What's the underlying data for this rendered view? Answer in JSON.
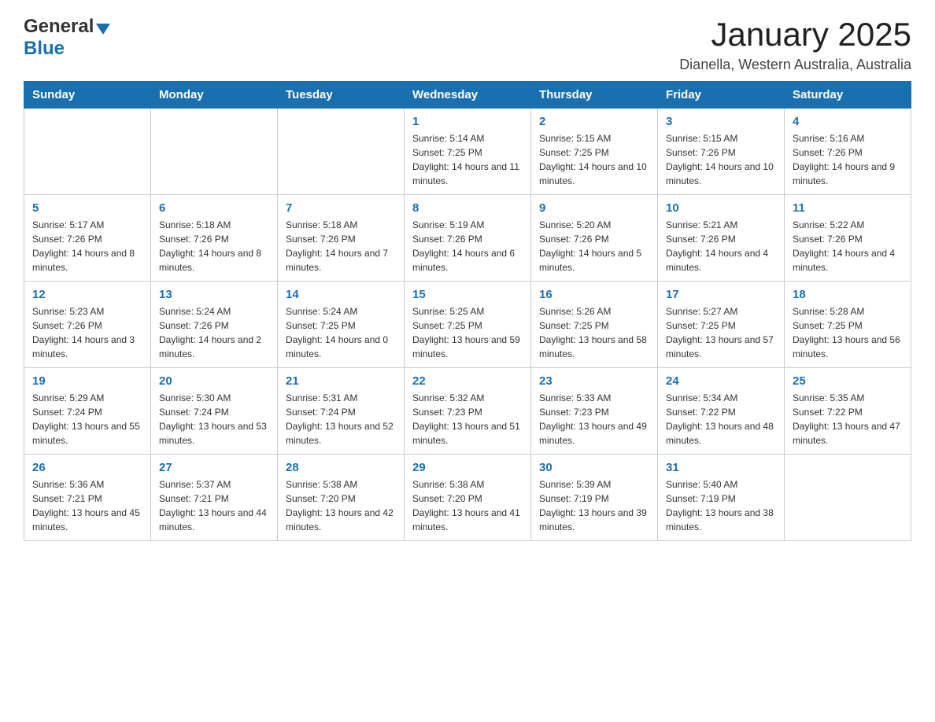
{
  "logo": {
    "general": "General",
    "blue": "Blue"
  },
  "header": {
    "month_year": "January 2025",
    "location": "Dianella, Western Australia, Australia"
  },
  "days_of_week": [
    "Sunday",
    "Monday",
    "Tuesday",
    "Wednesday",
    "Thursday",
    "Friday",
    "Saturday"
  ],
  "weeks": [
    [
      {
        "day": "",
        "info": ""
      },
      {
        "day": "",
        "info": ""
      },
      {
        "day": "",
        "info": ""
      },
      {
        "day": "1",
        "info": "Sunrise: 5:14 AM\nSunset: 7:25 PM\nDaylight: 14 hours and 11 minutes."
      },
      {
        "day": "2",
        "info": "Sunrise: 5:15 AM\nSunset: 7:25 PM\nDaylight: 14 hours and 10 minutes."
      },
      {
        "day": "3",
        "info": "Sunrise: 5:15 AM\nSunset: 7:26 PM\nDaylight: 14 hours and 10 minutes."
      },
      {
        "day": "4",
        "info": "Sunrise: 5:16 AM\nSunset: 7:26 PM\nDaylight: 14 hours and 9 minutes."
      }
    ],
    [
      {
        "day": "5",
        "info": "Sunrise: 5:17 AM\nSunset: 7:26 PM\nDaylight: 14 hours and 8 minutes."
      },
      {
        "day": "6",
        "info": "Sunrise: 5:18 AM\nSunset: 7:26 PM\nDaylight: 14 hours and 8 minutes."
      },
      {
        "day": "7",
        "info": "Sunrise: 5:18 AM\nSunset: 7:26 PM\nDaylight: 14 hours and 7 minutes."
      },
      {
        "day": "8",
        "info": "Sunrise: 5:19 AM\nSunset: 7:26 PM\nDaylight: 14 hours and 6 minutes."
      },
      {
        "day": "9",
        "info": "Sunrise: 5:20 AM\nSunset: 7:26 PM\nDaylight: 14 hours and 5 minutes."
      },
      {
        "day": "10",
        "info": "Sunrise: 5:21 AM\nSunset: 7:26 PM\nDaylight: 14 hours and 4 minutes."
      },
      {
        "day": "11",
        "info": "Sunrise: 5:22 AM\nSunset: 7:26 PM\nDaylight: 14 hours and 4 minutes."
      }
    ],
    [
      {
        "day": "12",
        "info": "Sunrise: 5:23 AM\nSunset: 7:26 PM\nDaylight: 14 hours and 3 minutes."
      },
      {
        "day": "13",
        "info": "Sunrise: 5:24 AM\nSunset: 7:26 PM\nDaylight: 14 hours and 2 minutes."
      },
      {
        "day": "14",
        "info": "Sunrise: 5:24 AM\nSunset: 7:25 PM\nDaylight: 14 hours and 0 minutes."
      },
      {
        "day": "15",
        "info": "Sunrise: 5:25 AM\nSunset: 7:25 PM\nDaylight: 13 hours and 59 minutes."
      },
      {
        "day": "16",
        "info": "Sunrise: 5:26 AM\nSunset: 7:25 PM\nDaylight: 13 hours and 58 minutes."
      },
      {
        "day": "17",
        "info": "Sunrise: 5:27 AM\nSunset: 7:25 PM\nDaylight: 13 hours and 57 minutes."
      },
      {
        "day": "18",
        "info": "Sunrise: 5:28 AM\nSunset: 7:25 PM\nDaylight: 13 hours and 56 minutes."
      }
    ],
    [
      {
        "day": "19",
        "info": "Sunrise: 5:29 AM\nSunset: 7:24 PM\nDaylight: 13 hours and 55 minutes."
      },
      {
        "day": "20",
        "info": "Sunrise: 5:30 AM\nSunset: 7:24 PM\nDaylight: 13 hours and 53 minutes."
      },
      {
        "day": "21",
        "info": "Sunrise: 5:31 AM\nSunset: 7:24 PM\nDaylight: 13 hours and 52 minutes."
      },
      {
        "day": "22",
        "info": "Sunrise: 5:32 AM\nSunset: 7:23 PM\nDaylight: 13 hours and 51 minutes."
      },
      {
        "day": "23",
        "info": "Sunrise: 5:33 AM\nSunset: 7:23 PM\nDaylight: 13 hours and 49 minutes."
      },
      {
        "day": "24",
        "info": "Sunrise: 5:34 AM\nSunset: 7:22 PM\nDaylight: 13 hours and 48 minutes."
      },
      {
        "day": "25",
        "info": "Sunrise: 5:35 AM\nSunset: 7:22 PM\nDaylight: 13 hours and 47 minutes."
      }
    ],
    [
      {
        "day": "26",
        "info": "Sunrise: 5:36 AM\nSunset: 7:21 PM\nDaylight: 13 hours and 45 minutes."
      },
      {
        "day": "27",
        "info": "Sunrise: 5:37 AM\nSunset: 7:21 PM\nDaylight: 13 hours and 44 minutes."
      },
      {
        "day": "28",
        "info": "Sunrise: 5:38 AM\nSunset: 7:20 PM\nDaylight: 13 hours and 42 minutes."
      },
      {
        "day": "29",
        "info": "Sunrise: 5:38 AM\nSunset: 7:20 PM\nDaylight: 13 hours and 41 minutes."
      },
      {
        "day": "30",
        "info": "Sunrise: 5:39 AM\nSunset: 7:19 PM\nDaylight: 13 hours and 39 minutes."
      },
      {
        "day": "31",
        "info": "Sunrise: 5:40 AM\nSunset: 7:19 PM\nDaylight: 13 hours and 38 minutes."
      },
      {
        "day": "",
        "info": ""
      }
    ]
  ]
}
